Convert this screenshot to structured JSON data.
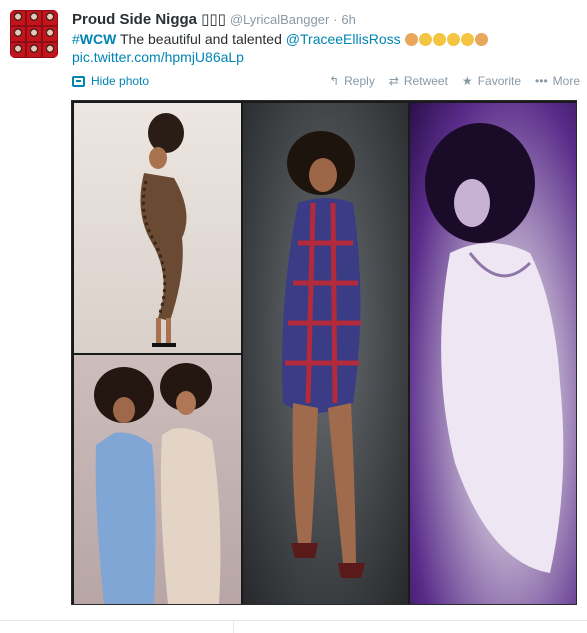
{
  "tweet": {
    "display_name": "Proud Side Nigga 🔥🔥🔥",
    "display_name_shown": "Proud Side Nigga ▯▯▯",
    "handle": "@LyricalBangger",
    "separator": "·",
    "time": "6h",
    "text": {
      "hashtag_hash": "#",
      "hashtag_word": "WCW",
      "body": " The beautiful and talented ",
      "mention": "@TraceeEllisRoss",
      "link": "pic.twitter.com/hpmjU86aLp"
    },
    "emoji_names": [
      "clap-emoji",
      "weary-emoji",
      "kiss-emoji",
      "smirk-emoji",
      "heart-eyes-emoji",
      "ok-hand-emoji"
    ],
    "emoji_colors": [
      "#e8a75a",
      "#f4c542",
      "#f4c542",
      "#f4c542",
      "#f4c542",
      "#e8a75a"
    ]
  },
  "actions": {
    "hide_photo": "Hide photo",
    "reply": "Reply",
    "retweet": "Retweet",
    "favorite": "Favorite",
    "more": "More",
    "icons": {
      "hide_photo": "photo-icon",
      "reply": "reply-icon",
      "retweet": "retweet-icon",
      "favorite": "star-icon",
      "more": "ellipsis-icon"
    }
  },
  "colors": {
    "link": "#0084b4",
    "meta": "#8899a6",
    "text": "#292f33"
  }
}
